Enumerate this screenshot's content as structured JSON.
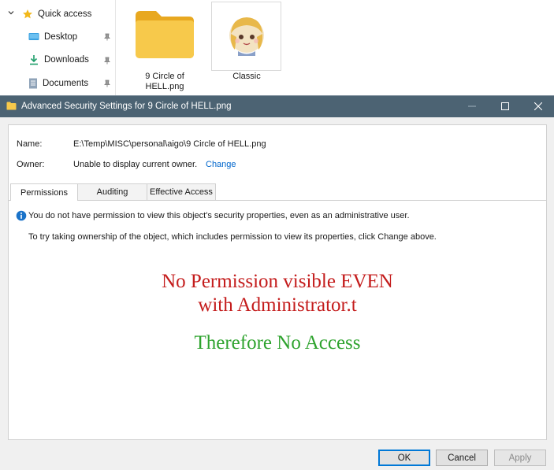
{
  "explorer": {
    "nav": {
      "quick_access": "Quick access",
      "items": [
        {
          "label": "Desktop",
          "icon": "desktop-icon"
        },
        {
          "label": "Downloads",
          "icon": "download-icon"
        },
        {
          "label": "Documents",
          "icon": "document-icon"
        }
      ]
    },
    "files": [
      {
        "label": "9 Circle of HELL.png",
        "icon": "folder-icon"
      },
      {
        "label": "Classic",
        "icon": "avatar-icon"
      }
    ]
  },
  "dialog": {
    "title": "Advanced Security Settings for 9 Circle of HELL.png",
    "name_label": "Name:",
    "name_value": "E:\\Temp\\MISC\\personal\\aigo\\9 Circle of HELL.png",
    "owner_label": "Owner:",
    "owner_value": "Unable to display current owner.",
    "change_link": "Change",
    "tabs": [
      "Permissions",
      "Auditing",
      "Effective Access"
    ],
    "active_tab": "Permissions",
    "message_1": "You do not have permission to view this object's security properties, even as an administrative user.",
    "message_2": "To try taking ownership of the object, which includes permission to view its properties, click Change above.",
    "annotation_red_1": "No Permission visible EVEN",
    "annotation_red_2": "with Administrator.t",
    "annotation_green": "Therefore No Access",
    "buttons": {
      "ok": "OK",
      "cancel": "Cancel",
      "apply": "Apply"
    }
  },
  "colors": {
    "titlebar": "#4c6373",
    "annotation_red": "#c41c1c",
    "annotation_green": "#2ea32e",
    "link": "#0066cc",
    "folder": "#f7c94b"
  }
}
